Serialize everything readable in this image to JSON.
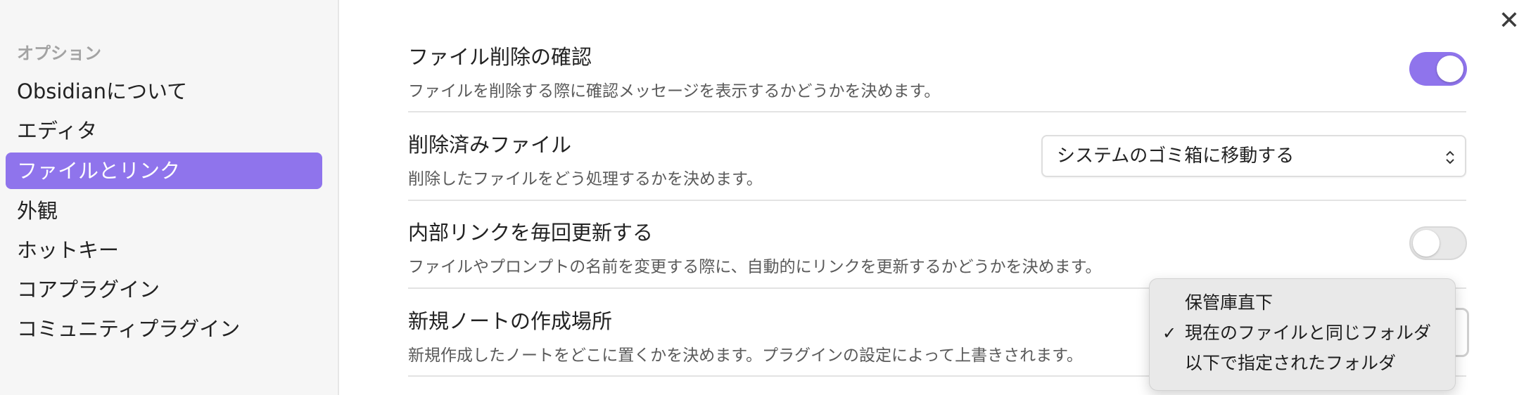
{
  "sidebar": {
    "heading": "オプション",
    "items": [
      {
        "label": "Obsidianについて"
      },
      {
        "label": "エディタ"
      },
      {
        "label": "ファイルとリンク"
      },
      {
        "label": "外観"
      },
      {
        "label": "ホットキー"
      },
      {
        "label": "コアプラグイン"
      },
      {
        "label": "コミュニティプラグイン"
      }
    ]
  },
  "window": {
    "close_icon": "✕"
  },
  "settings": [
    {
      "title": "ファイル削除の確認",
      "desc": "ファイルを削除する際に確認メッセージを表示するかどうかを決めます。",
      "control": "toggle",
      "enabled": true
    },
    {
      "title": "削除済みファイル",
      "desc": "削除したファイルをどう処理するかを決めます。",
      "control": "select",
      "value": "システムのゴミ箱に移動する"
    },
    {
      "title": "内部リンクを毎回更新する",
      "desc": "ファイルやプロンプトの名前を変更する際に、自動的にリンクを更新するかどうかを決めます。",
      "control": "toggle",
      "enabled": false
    },
    {
      "title": "新規ノートの作成場所",
      "desc": "新規作成したノートをどこに置くかを決めます。プラグインの設定によって上書きされます。",
      "control": "select"
    }
  ],
  "dropdown": {
    "check_icon": "✓",
    "options": [
      {
        "label": "保管庫直下",
        "selected": false
      },
      {
        "label": "現在のファイルと同じフォルダ",
        "selected": true
      },
      {
        "label": "以下で指定されたフォルダ",
        "selected": false
      }
    ]
  },
  "colors": {
    "accent": "#8f74ec",
    "sidebar_bg": "#f6f6f6"
  },
  "icons": {
    "close": "close-icon",
    "select": "chevron-updown-icon",
    "check": "checkmark-icon"
  }
}
